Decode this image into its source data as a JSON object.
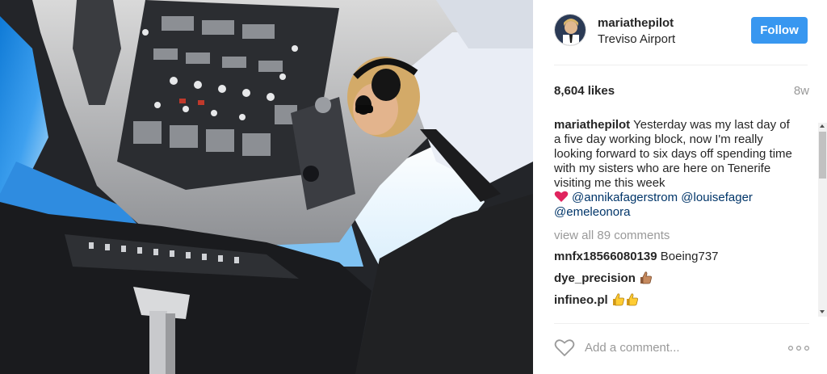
{
  "post": {
    "username": "mariathepilot",
    "location": "Treviso Airport",
    "follow_label": "Follow",
    "likes": "8,604 likes",
    "time_ago": "8w",
    "caption": {
      "username": "mariathepilot",
      "text": "Yesterday was my last day of a five day working block, now I'm really looking forward to six days off spending time with my sisters who are here on Tenerife visiting me this week",
      "mention_1": "@annikafagerstrom",
      "mention_2": "@louisefager",
      "mention_3": "@emeleonora"
    },
    "view_all_comments": "view all 89 comments",
    "comments": [
      {
        "username": "mnfx18566080139",
        "text": "Boeing737"
      },
      {
        "username": "dye_precision",
        "text": ""
      },
      {
        "username": "infineo.pl",
        "text": ""
      }
    ],
    "add_comment_placeholder": "Add a comment..."
  },
  "icons": {
    "heart_emoji": "red-heart-emoji",
    "thumb_emoji": "thumbs-up-emoji",
    "like": "heart-outline-icon",
    "more": "more-options-icon"
  },
  "colors": {
    "follow_button": "#3897f0",
    "mention": "#003569",
    "muted_text": "#999999"
  }
}
